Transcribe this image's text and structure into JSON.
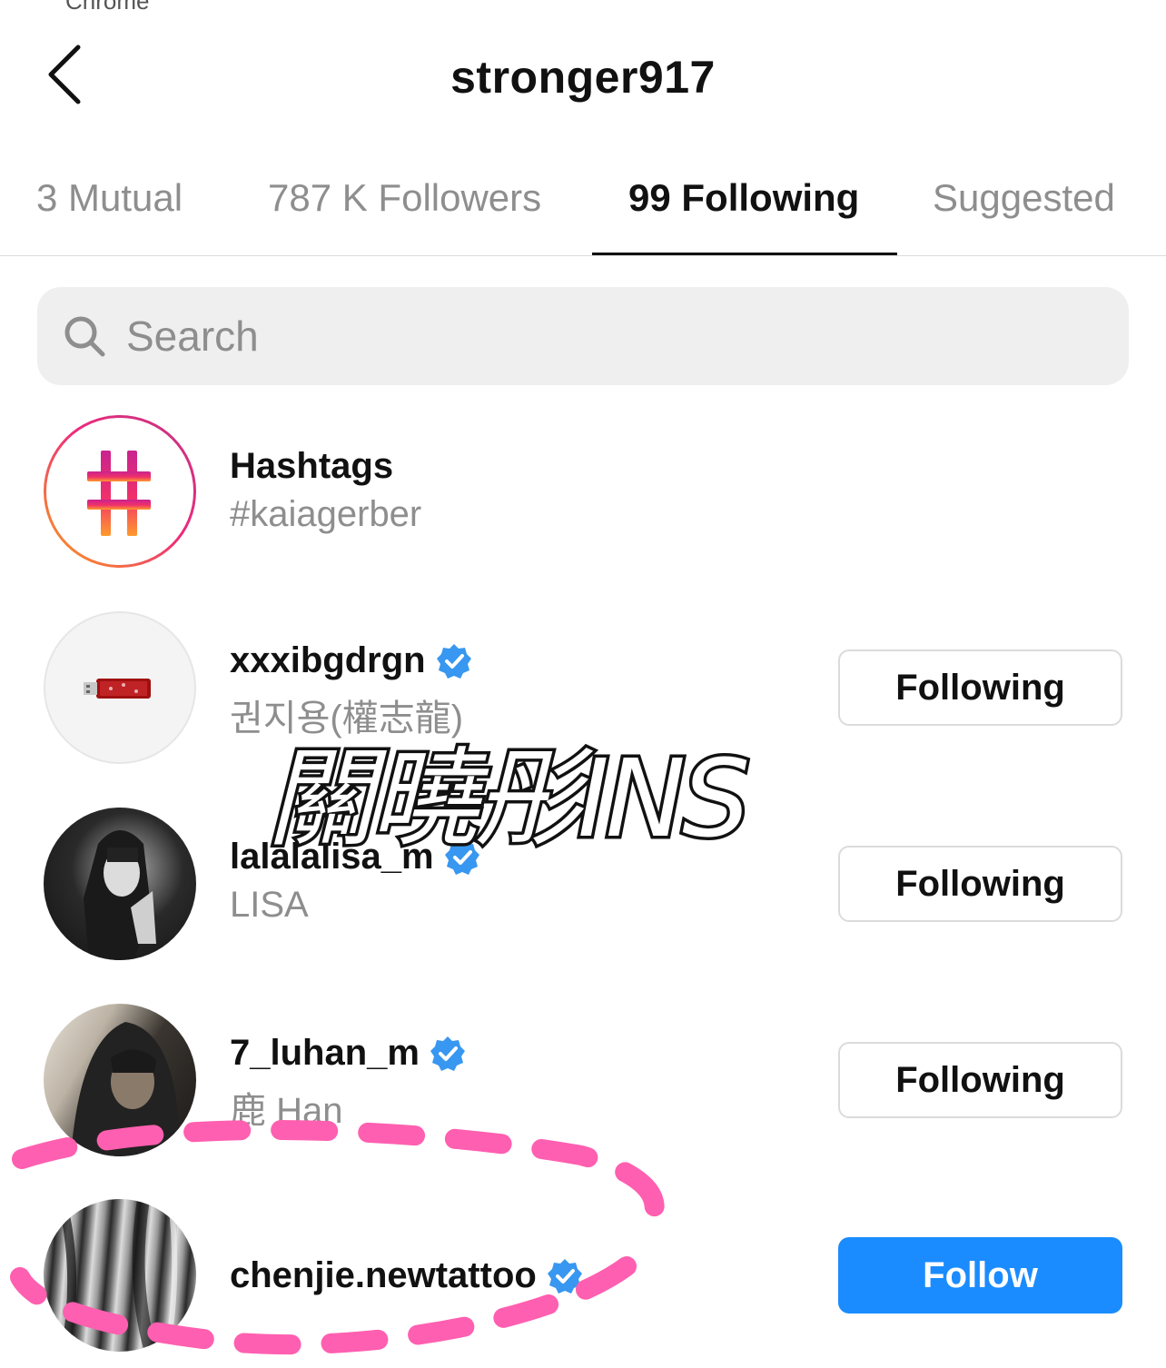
{
  "header": {
    "title": "stronger917"
  },
  "tabs": [
    {
      "label": "3 Mutual",
      "active": false
    },
    {
      "label": "787 K Followers",
      "active": false
    },
    {
      "label": "99 Following",
      "active": true
    },
    {
      "label": "Suggested",
      "active": false
    }
  ],
  "search": {
    "placeholder": "Search",
    "value": ""
  },
  "hashtags": {
    "title": "Hashtags",
    "tag": "#kaiagerber"
  },
  "accounts": [
    {
      "username": "xxxibgdrgn",
      "subname": "권지용(權志龍)",
      "verified": true,
      "button": "Following"
    },
    {
      "username": "lalalalisa_m",
      "subname": "LISA",
      "verified": true,
      "button": "Following"
    },
    {
      "username": "7_luhan_m",
      "subname": "鹿 Han",
      "verified": true,
      "button": "Following"
    },
    {
      "username": "chenjie.newtattoo",
      "subname": "",
      "verified": true,
      "button": "Follow"
    }
  ],
  "overlay": {
    "watermark": "關曉彤INS"
  },
  "colors": {
    "follow_blue": "#1a8cff",
    "verified_blue": "#3897f0",
    "annotation_pink": "#ff5fb0"
  },
  "icons": [
    "back-arrow-icon",
    "search-icon",
    "hashtag-icon",
    "verified-icon"
  ]
}
